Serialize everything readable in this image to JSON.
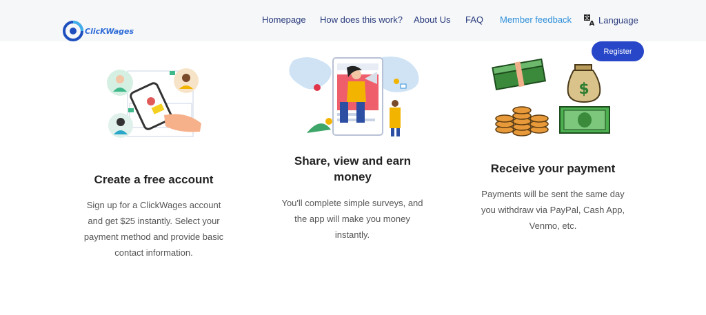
{
  "brand": {
    "name": "ClicKWages"
  },
  "nav": {
    "items": [
      {
        "label": "Homepage"
      },
      {
        "label": "How does this work?"
      },
      {
        "label": "About Us"
      },
      {
        "label": "FAQ"
      },
      {
        "label": "Member feedback",
        "active": true
      }
    ],
    "language_label": "Language"
  },
  "register_label": "Register",
  "steps": [
    {
      "title": "Create a free account",
      "description": "Sign up for a ClickWages account and get $25 instantly. Select your payment method and provide basic contact information."
    },
    {
      "title": "Share, view and earn money",
      "description": "You'll complete simple surveys, and the app will make you money instantly."
    },
    {
      "title": "Receive your payment",
      "description": "Payments will be sent the same day you withdraw via PayPal, Cash App, Venmo, etc."
    }
  ],
  "colors": {
    "header_bg": "#f5f7f9",
    "nav_text": "#2a3a7c",
    "nav_active": "#2f8fd9",
    "register_bg": "#2747c8",
    "brand": "#2e6bd6"
  }
}
